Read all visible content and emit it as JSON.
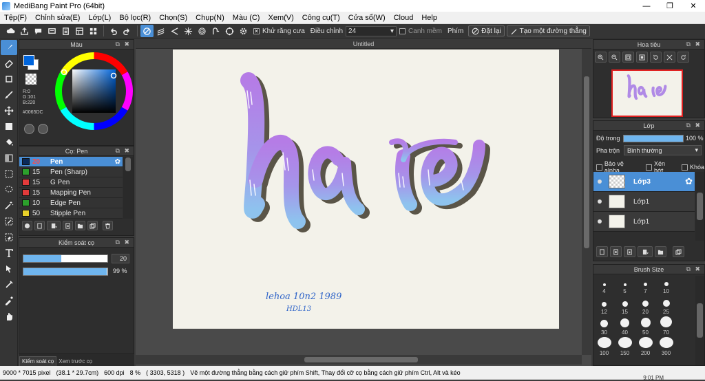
{
  "window": {
    "title": "MediBang Paint Pro (64bit)",
    "minimize": "—",
    "maximize": "❐",
    "close": "✕"
  },
  "menu": [
    "Tệp(F)",
    "Chỉnh sửa(E)",
    "Lớp(L)",
    "Bộ lọc(R)",
    "Chọn(S)",
    "Chụp(N)",
    "Màu (C)",
    "Xem(V)",
    "Công cụ(T)",
    "Cửa sổ(W)",
    "Cloud",
    "Help"
  ],
  "toolbar": {
    "antialias_label": "Khử răng cưa",
    "adjust_label": "Điều chỉnh",
    "adjust_value": "24",
    "snap_label": "Canh mềm",
    "key_label": "Phím",
    "reset_label": "Đặt lại",
    "straight_label": "Tạo một đường thẳng"
  },
  "color_panel": {
    "title": "Màu",
    "r": "R:0",
    "g": "G:101",
    "b": "B:220",
    "hex": "#0065DC",
    "primary": "#0065DC",
    "secondary": "#ffffff"
  },
  "brush_panel": {
    "title": "Cọ: Pen",
    "items": [
      {
        "size": "20",
        "name": "Pen",
        "color": "#0a2a5a",
        "selected": true
      },
      {
        "size": "15",
        "name": "Pen (Sharp)",
        "color": "#2ca02c",
        "selected": false
      },
      {
        "size": "15",
        "name": "G Pen",
        "color": "#e33b3b",
        "selected": false
      },
      {
        "size": "15",
        "name": "Mapping Pen",
        "color": "#e33b3b",
        "selected": false
      },
      {
        "size": "10",
        "name": "Edge Pen",
        "color": "#2ca02c",
        "selected": false
      },
      {
        "size": "50",
        "name": "Stipple Pen",
        "color": "#e8d12a",
        "selected": false
      }
    ]
  },
  "brush_control": {
    "title": "Kiểm soát cọ",
    "size_value": "20",
    "size_fraction": 0.45,
    "opacity_value": "99 %",
    "opacity_fraction": 0.99,
    "tab_control": "Kiểm soát cọ",
    "tab_preview": "Xem trước cọ"
  },
  "canvas": {
    "tab": "Untitled",
    "signature_line1": "lehoa 10n2 1989",
    "signature_line2": "HDL13"
  },
  "navigator": {
    "title": "Hoa tiêu"
  },
  "layer_panel": {
    "title": "Lớp",
    "opacity_label": "Độ trong",
    "opacity_value": "100 %",
    "opacity_fraction": 1.0,
    "blend_label": "Pha trộn",
    "blend_value": "Bình thường",
    "protect_alpha": "Bảo vệ alpha",
    "clipping": "Xén bớt",
    "lock": "Khóa",
    "layers": [
      {
        "name": "Lớp3",
        "selected": true
      },
      {
        "name": "Lớp1",
        "selected": false
      },
      {
        "name": "Lớp1",
        "selected": false
      }
    ]
  },
  "brush_size_panel": {
    "title": "Brush Size",
    "sizes": [
      "4",
      "5",
      "7",
      "10",
      "12",
      "15",
      "20",
      "25",
      "30",
      "40",
      "50",
      "70",
      "100",
      "150",
      "200",
      "300"
    ]
  },
  "status": {
    "size_px": "9000 * 7015 pixel",
    "size_cm": "(38.1 * 29.7cm)",
    "dpi": "600 dpi",
    "zoom": "8 %",
    "coords": "( 3303, 5318 )",
    "hint": "Vẽ một đường thẳng bằng cách giữ phím Shift, Thay đổi cỡ cọ bằng cách giữ phím Ctrl, Alt và kéo",
    "time": "9:01 PM"
  }
}
